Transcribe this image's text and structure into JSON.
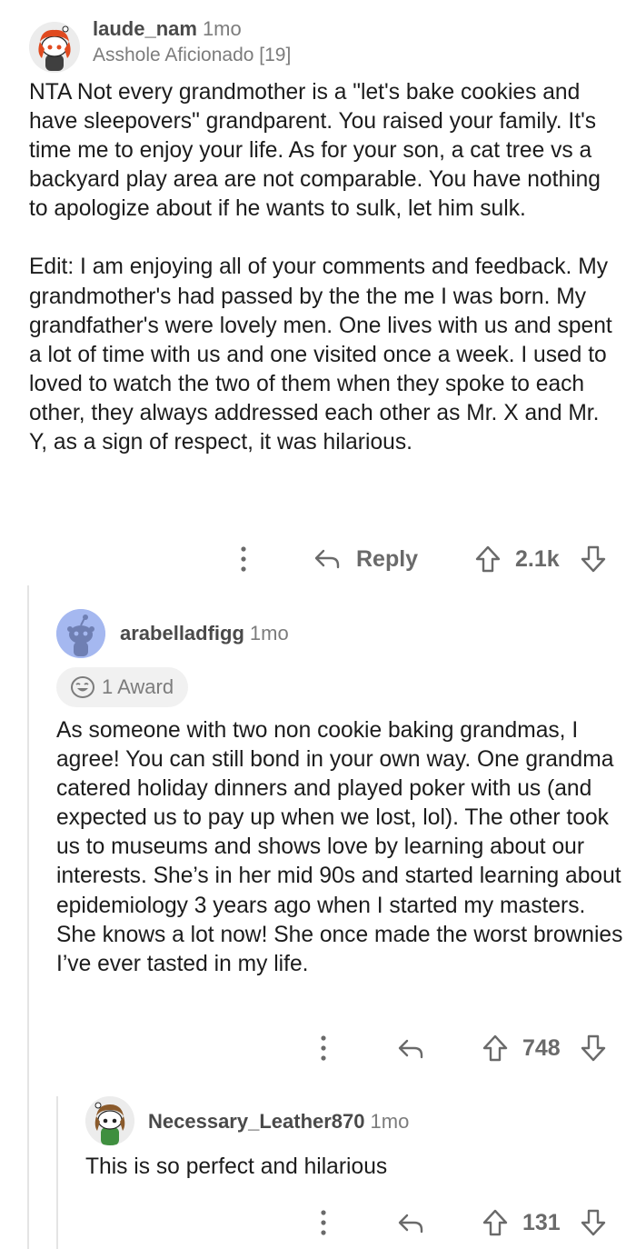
{
  "comments": [
    {
      "username": "laude_nam",
      "age": "1mo",
      "flair": "Asshole Aficionado [19]",
      "paragraphs": [
        "NTA Not every grandmother is a \"let's  bake cookies and have sleepovers\" grandparent. You raised your family. It's time me to enjoy your life. As for your son, a cat tree vs a backyard play area are not comparable. You have nothing to apologize about if he wants to sulk, let him sulk.",
        "Edit: I am enjoying all of your comments and feedback. My grandmother's had passed by the the me I was born. My grandfather's were lovely men. One lives with us and spent a lot of time with us and one visited once a week. I used to loved to watch the two of them when they spoke to each other, they always addressed each other as Mr. X and Mr. Y, as a sign of respect, it was hilarious."
      ],
      "reply_label": "Reply",
      "votes": "2.1k",
      "avatar_icon": "snoo-avatar-red-hair"
    },
    {
      "username": "arabelladfigg",
      "age": "1mo",
      "award_label": "1 Award",
      "award_icon": "laughing-face-award-icon",
      "paragraphs": [
        "As someone with two non cookie baking grandmas, I agree! You can still bond in your own way. One grandma catered holiday dinners and played poker with us (and expected us to pay up when we lost, lol). The other took us to museums and shows love by learning about our interests. She’s in her mid 90s and started learning about epidemiology 3 years ago when I started my masters. She knows a lot now! She once made the worst brownies I’ve ever tasted in my life."
      ],
      "votes": "748",
      "avatar_icon": "default-snoo-avatar"
    },
    {
      "username": "Necessary_Leather870",
      "age": "1mo",
      "paragraphs": [
        "This is so perfect and hilarious"
      ],
      "votes": "131",
      "avatar_icon": "snoo-avatar-green"
    }
  ],
  "colors": {
    "text": "#1c1c1c",
    "meta": "#7c7c7c",
    "icon": "#6a6a6a",
    "thread_line": "#e4e4e4",
    "default_avatar": "#a5b8f0"
  }
}
